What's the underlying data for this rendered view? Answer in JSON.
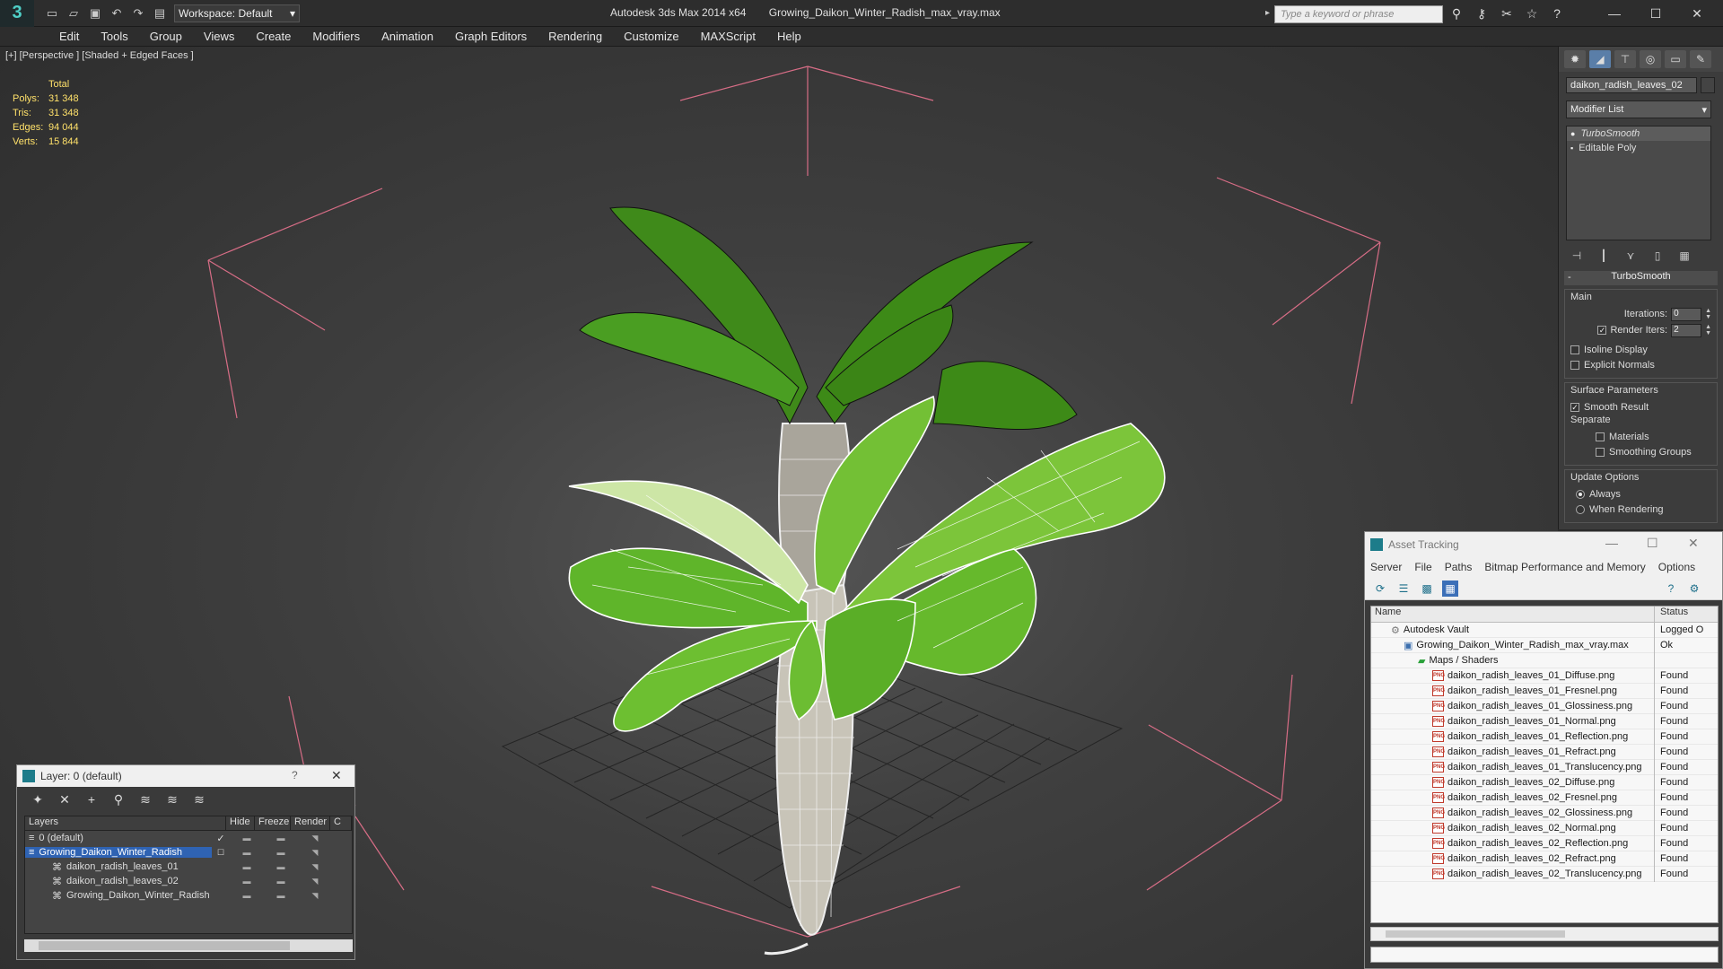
{
  "titlebar": {
    "workspace": "Workspace: Default",
    "app_name": "Autodesk 3ds Max  2014 x64",
    "file_name": "Growing_Daikon_Winter_Radish_max_vray.max",
    "search_placeholder": "Type a keyword or phrase"
  },
  "menu": [
    "Edit",
    "Tools",
    "Group",
    "Views",
    "Create",
    "Modifiers",
    "Animation",
    "Graph Editors",
    "Rendering",
    "Customize",
    "MAXScript",
    "Help"
  ],
  "viewport": {
    "label": "[+] [Perspective ] [Shaded + Edged Faces ]",
    "stats_header": "Total",
    "stats": [
      {
        "k": "Polys:",
        "v": "31 348"
      },
      {
        "k": "Tris:",
        "v": "31 348"
      },
      {
        "k": "Edges:",
        "v": "94 044"
      },
      {
        "k": "Verts:",
        "v": "15 844"
      }
    ]
  },
  "cmdpanel": {
    "object_name": "daikon_radish_leaves_02",
    "modifier_list": "Modifier List",
    "stack": [
      "TurboSmooth",
      "Editable Poly"
    ],
    "rollout_title": "TurboSmooth",
    "main_group": "Main",
    "iterations_label": "Iterations:",
    "iterations_value": "0",
    "render_iters_label": "Render Iters:",
    "render_iters_value": "2",
    "isoline": "Isoline Display",
    "explicit_normals": "Explicit Normals",
    "surface_params": "Surface Parameters",
    "smooth_result": "Smooth Result",
    "separate": "Separate",
    "materials": "Materials",
    "smoothing_groups": "Smoothing Groups",
    "update_options": "Update Options",
    "always": "Always",
    "when_rendering": "When Rendering"
  },
  "layer_window": {
    "title": "Layer: 0 (default)",
    "help": "?",
    "columns": [
      "Layers",
      "Hide",
      "Freeze",
      "Render",
      "C"
    ],
    "rows": [
      {
        "name": "0 (default)"
      },
      {
        "name": "Growing_Daikon_Winter_Radish"
      },
      {
        "name": "daikon_radish_leaves_01"
      },
      {
        "name": "daikon_radish_leaves_02"
      },
      {
        "name": "Growing_Daikon_Winter_Radish"
      }
    ]
  },
  "asset_window": {
    "title": "Asset Tracking",
    "menu": [
      "Server",
      "File",
      "Paths",
      "Bitmap Performance and Memory",
      "Options"
    ],
    "col_name": "Name",
    "col_status": "Status",
    "rows": [
      {
        "name": "Autodesk Vault",
        "status": "Logged O",
        "kind": "vault"
      },
      {
        "name": "Growing_Daikon_Winter_Radish_max_vray.max",
        "status": "Ok",
        "kind": "max"
      },
      {
        "name": "Maps / Shaders",
        "status": "",
        "kind": "folder"
      },
      {
        "name": "daikon_radish_leaves_01_Diffuse.png",
        "status": "Found",
        "kind": "png"
      },
      {
        "name": "daikon_radish_leaves_01_Fresnel.png",
        "status": "Found",
        "kind": "png"
      },
      {
        "name": "daikon_radish_leaves_01_Glossiness.png",
        "status": "Found",
        "kind": "png"
      },
      {
        "name": "daikon_radish_leaves_01_Normal.png",
        "status": "Found",
        "kind": "png"
      },
      {
        "name": "daikon_radish_leaves_01_Reflection.png",
        "status": "Found",
        "kind": "png"
      },
      {
        "name": "daikon_radish_leaves_01_Refract.png",
        "status": "Found",
        "kind": "png"
      },
      {
        "name": "daikon_radish_leaves_01_Translucency.png",
        "status": "Found",
        "kind": "png"
      },
      {
        "name": "daikon_radish_leaves_02_Diffuse.png",
        "status": "Found",
        "kind": "png"
      },
      {
        "name": "daikon_radish_leaves_02_Fresnel.png",
        "status": "Found",
        "kind": "png"
      },
      {
        "name": "daikon_radish_leaves_02_Glossiness.png",
        "status": "Found",
        "kind": "png"
      },
      {
        "name": "daikon_radish_leaves_02_Normal.png",
        "status": "Found",
        "kind": "png"
      },
      {
        "name": "daikon_radish_leaves_02_Reflection.png",
        "status": "Found",
        "kind": "png"
      },
      {
        "name": "daikon_radish_leaves_02_Refract.png",
        "status": "Found",
        "kind": "png"
      },
      {
        "name": "daikon_radish_leaves_02_Translucency.png",
        "status": "Found",
        "kind": "png"
      }
    ],
    "png_badge": "PNG"
  }
}
